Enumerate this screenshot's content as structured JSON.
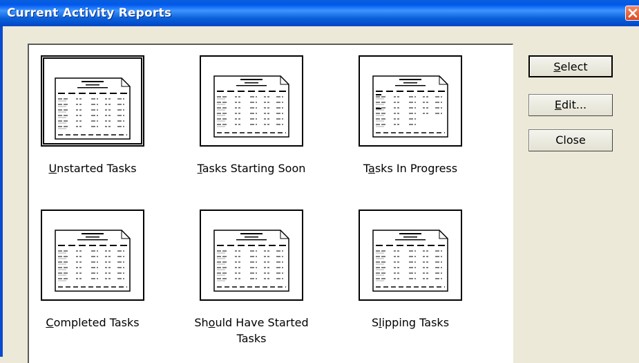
{
  "window": {
    "title": "Current Activity Reports"
  },
  "buttons": {
    "select": {
      "pre": "",
      "key": "S",
      "post": "elect"
    },
    "edit": {
      "pre": "",
      "key": "E",
      "post": "dit..."
    },
    "close": {
      "label": "Close"
    }
  },
  "reports": [
    {
      "pre": "",
      "key": "U",
      "post": "nstarted Tasks",
      "line2": "",
      "selected": true
    },
    {
      "pre": "",
      "key": "T",
      "post": "asks Starting Soon",
      "line2": "",
      "selected": false
    },
    {
      "pre": "T",
      "key": "a",
      "post": "sks In Progress",
      "line2": "",
      "selected": false
    },
    {
      "pre": "",
      "key": "C",
      "post": "ompleted Tasks",
      "line2": "",
      "selected": false
    },
    {
      "pre": "Sh",
      "key": "o",
      "post": "uld Have Started",
      "line2": "Tasks",
      "selected": false
    },
    {
      "pre": "S",
      "key": "l",
      "post": "ipping Tasks",
      "line2": "",
      "selected": false
    }
  ]
}
